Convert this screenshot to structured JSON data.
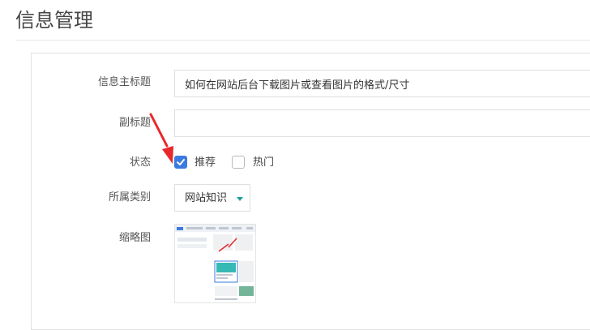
{
  "page": {
    "title": "信息管理"
  },
  "form": {
    "main_title": {
      "label": "信息主标题",
      "value": "如何在网站后台下载图片或查看图片的格式/尺寸"
    },
    "subtitle": {
      "label": "副标题",
      "value": "",
      "placeholder": ""
    },
    "status": {
      "label": "状态",
      "options": [
        {
          "label": "推荐",
          "checked": true
        },
        {
          "label": "热门",
          "checked": false
        }
      ]
    },
    "category": {
      "label": "所属类别",
      "selected": "网站知识"
    },
    "thumbnail": {
      "label": "缩略图"
    }
  },
  "annotation": {
    "arrow_color": "#e8282b"
  },
  "colors": {
    "checkbox_accent": "#3b7be0",
    "caret": "#1ba1a1"
  }
}
